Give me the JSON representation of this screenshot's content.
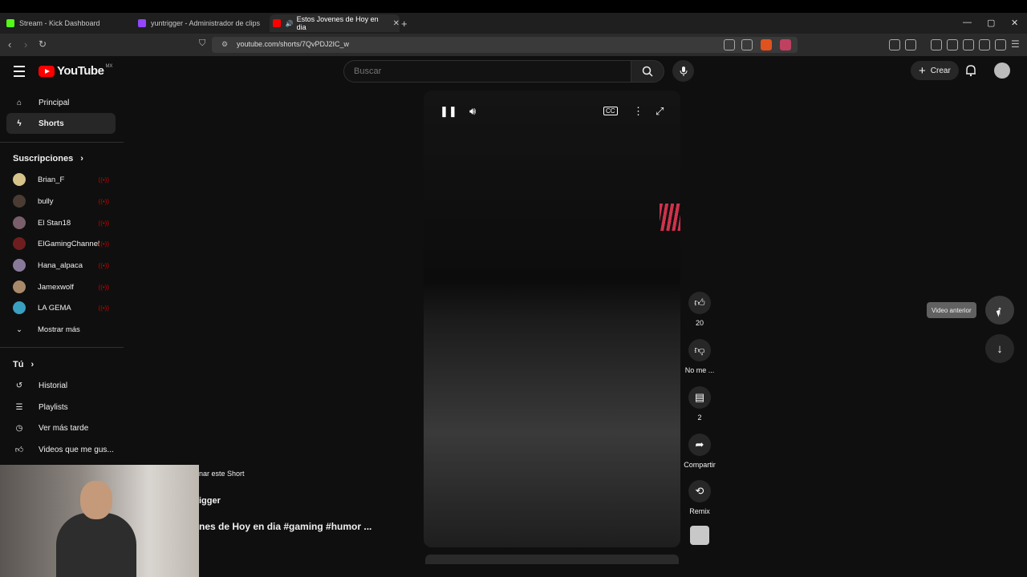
{
  "browser": {
    "tabs": [
      {
        "label": "Stream - Kick Dashboard",
        "color": "#53fc18"
      },
      {
        "label": "yuntrigger - Administrador de clips",
        "color": "#9146ff"
      },
      {
        "label": "Estos Jovenes de Hoy en dia",
        "color": "#ff0000"
      }
    ],
    "url": "youtube.com/shorts/7QvPDJ2IC_w"
  },
  "header": {
    "logo": "YouTube",
    "country": "MX",
    "search_placeholder": "Buscar",
    "create_label": "Crear"
  },
  "sidebar": {
    "main": [
      {
        "label": "Principal",
        "icon": "home-icon"
      },
      {
        "label": "Shorts",
        "icon": "shorts-icon"
      }
    ],
    "subscriptions_title": "Suscripciones",
    "subscriptions": [
      {
        "name": "Brian_F",
        "color": "#d6c38a"
      },
      {
        "name": "bully",
        "color": "#4a3c33"
      },
      {
        "name": "El Stan18",
        "color": "#7a5e6a"
      },
      {
        "name": "ElGamingChannel",
        "color": "#6e1e1e"
      },
      {
        "name": "Hana_alpaca",
        "color": "#8a7a9a"
      },
      {
        "name": "Jamexwolf",
        "color": "#a88a6a"
      },
      {
        "name": "LA GEMA",
        "color": "#3aa0c0"
      }
    ],
    "show_more": "Mostrar más",
    "you_title": "Tú",
    "you_items": [
      {
        "label": "Historial",
        "icon": "history-icon"
      },
      {
        "label": "Playlists",
        "icon": "playlist-icon"
      },
      {
        "label": "Ver más tarde",
        "icon": "clock-icon"
      },
      {
        "label": "Videos que me gus...",
        "icon": "thumbs-up-icon"
      }
    ]
  },
  "actions": {
    "likes": "20",
    "dislike_label": "No me ...",
    "comments": "2",
    "share_label": "Compartir",
    "remix_label": "Remix"
  },
  "nav": {
    "tooltip": "Video anterior"
  },
  "overlay": {
    "label": "nar este Short",
    "channel": "igger",
    "title": "nes de Hoy en dia #gaming #humor ..."
  }
}
